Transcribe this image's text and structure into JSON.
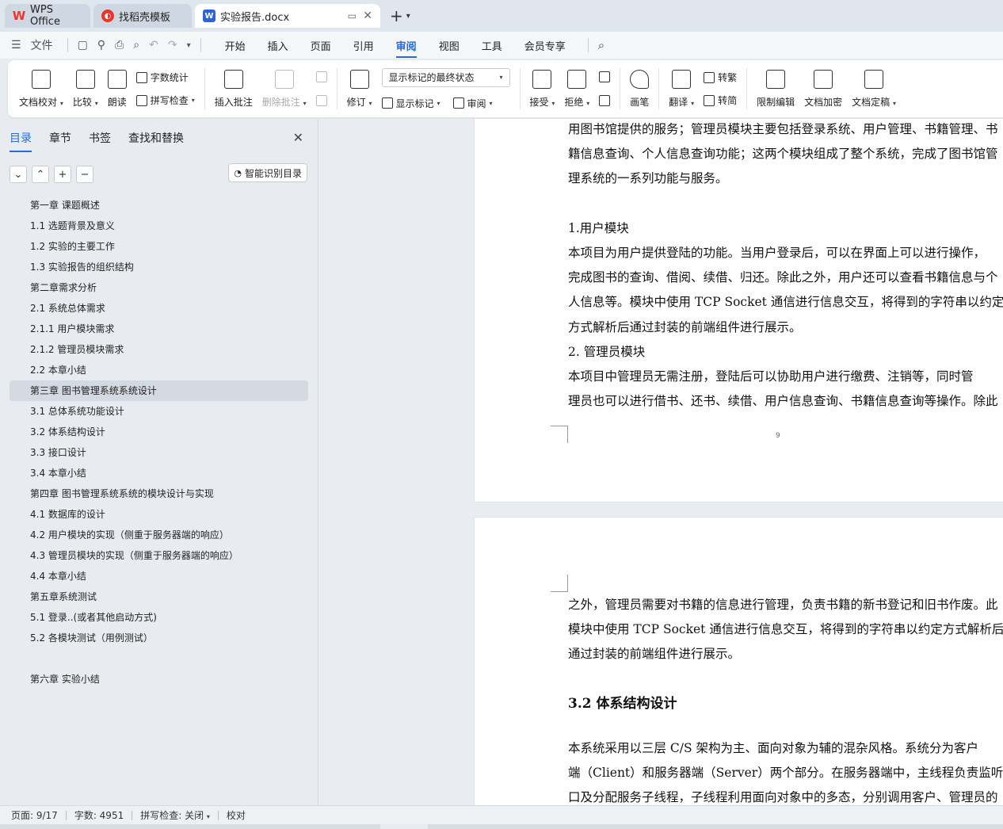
{
  "tabs": [
    {
      "label": "WPS Office",
      "icon": "wps-logo-icon"
    },
    {
      "label": "找稻壳模板",
      "icon": "docer-logo-icon"
    },
    {
      "label": "实验报告.docx",
      "icon": "word-doc-icon"
    }
  ],
  "menu": {
    "file": "文件",
    "items": [
      "开始",
      "插入",
      "页面",
      "引用",
      "审阅",
      "视图",
      "工具",
      "会员专享"
    ],
    "active": "审阅"
  },
  "ribbon": {
    "doc_check": "文档校对",
    "compare": "比较",
    "read_aloud": "朗读",
    "word_count": "字数统计",
    "spell_check": "拼写检查",
    "insert_comment": "插入批注",
    "delete_comment": "删除批注",
    "track_changes": "修订",
    "markup_select": "显示标记的最终状态",
    "show_markup": "显示标记",
    "review": "审阅",
    "accept": "接受",
    "reject": "拒绝",
    "pen": "画笔",
    "translate": "翻译",
    "to_traditional": "转繁",
    "to_simplified": "转简",
    "restrict_edit": "限制编辑",
    "encrypt": "文档加密",
    "finalize": "文档定稿"
  },
  "left_panel": {
    "tabs": [
      "目录",
      "章节",
      "书签",
      "查找和替换"
    ],
    "active_tab": "目录",
    "smart_toc": "智能识别目录",
    "toc": [
      "第一章  课题概述",
      "1.1 选题背景及意义",
      "1.2  实验的主要工作",
      "1.3  实验报告的组织结构",
      "第二章需求分析",
      "2.1   系统总体需求",
      "2.1.1  用户模块需求",
      "2.1.2     管理员模块需求",
      "2.2  本章小结",
      "第三章  图书管理系统系统设计",
      "3.1  总体系统功能设计",
      "3.2 体系结构设计",
      "3.3 接口设计",
      "3.4  本章小结",
      "第四章  图书管理系统系统的模块设计与实现",
      "4.1 数据库的设计",
      "4.2  用户模块的实现（侧重于服务器端的响应）",
      "4.3  管理员模块的实现（侧重于服务器端的响应）",
      "4.4  本章小结",
      "第五章系统测试",
      "5.1  登录..(或者其他启动方式)",
      "5.2  各模块测试（用例测试）",
      "",
      "第六章    实验小结"
    ],
    "selected_index": 9
  },
  "document": {
    "page1_lines": [
      "用图书馆提供的服务；管理员模块主要包括登录系统、用户管理、书籍管理、书",
      "籍信息查询、个人信息查询功能；这两个模块组成了整个系统，完成了图书馆管",
      "理系统的一系列功能与服务。",
      "",
      "1.用户模块",
      "        本项目为用户提供登陆的功能。当用户登录后，可以在界面上可以进行操作，",
      "完成图书的查询、借阅、续借、归还。除此之外，用户还可以查看书籍信息与个",
      "人信息等。模块中使用 TCP Socket 通信进行信息交互，将得到的字符串以约定",
      "方式解析后通过封装的前端组件进行展示。",
      "2.  管理员模块",
      "        本项目中管理员无需注册，登陆后可以协助用户进行缴费、注销等，同时管",
      "理员也可以进行借书、还书、续借、用户信息查询、书籍信息查询等操作。除此"
    ],
    "page_number": "9",
    "page2_lines": [
      "之外，管理员需要对书籍的信息进行管理，负责书籍的新书登记和旧书作废。此",
      "模块中使用 TCP Socket 通信进行信息交互，将得到的字符串以约定方式解析后",
      "通过封装的前端组件进行展示。"
    ],
    "heading": "3.2 体系结构设计",
    "page2_lines_b": [
      "        本系统采用以三层 C/S 架构为主、面向对象为辅的混杂风格。系统分为客户",
      "端（Client）和服务器端（Server）两个部分。在服务器端中，主线程负责监听端",
      "口及分配服务子线程，子线程利用面向对象中的多态，分别调用客户、管理员的"
    ]
  },
  "status": {
    "page": "页面: 9/17",
    "words": "字数: 4951",
    "spell": "拼写检查: 关闭",
    "proof": "校对"
  }
}
